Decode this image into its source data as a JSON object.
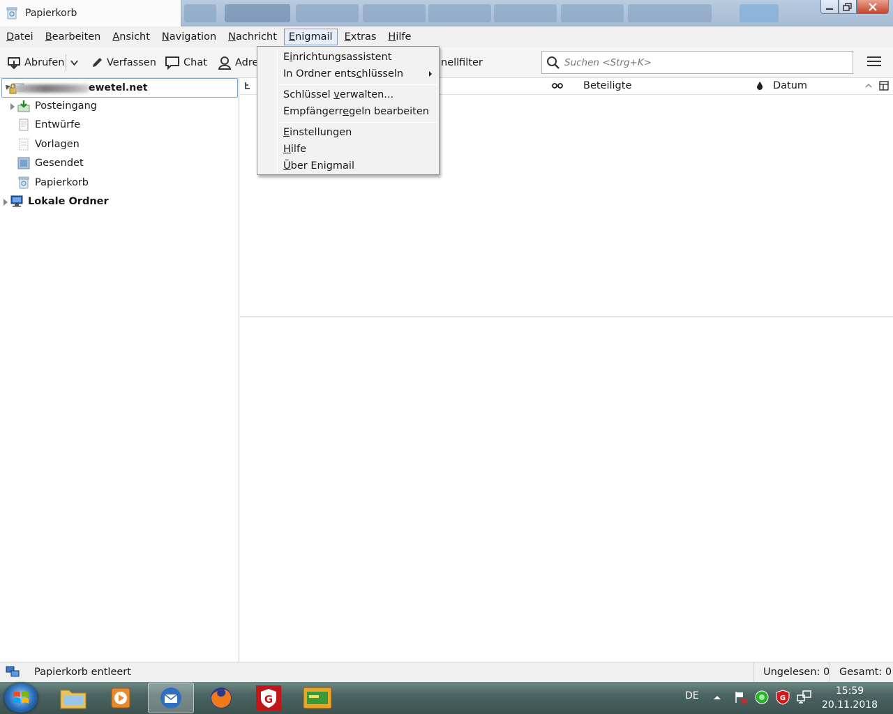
{
  "window": {
    "tab_title": "Papierkorb",
    "tab_icon": "trash-icon"
  },
  "menubar": {
    "items": [
      "Datei",
      "Bearbeiten",
      "Ansicht",
      "Navigation",
      "Nachricht",
      "Enigmail",
      "Extras",
      "Hilfe"
    ],
    "active": "Enigmail"
  },
  "toolbar": {
    "abrufen": "Abrufen",
    "verfassen": "Verfassen",
    "chat": "Chat",
    "adressbuch": "Adre",
    "schnellfilter": "nellfilter",
    "search_placeholder": "Suchen <Strg+K>"
  },
  "enigmail_menu": {
    "items": [
      {
        "label": "Einrichtungsassistent",
        "has_submenu": false
      },
      {
        "label": "In Ordner entschlüsseln",
        "has_submenu": true
      },
      {
        "label": "Schlüssel verwalten...",
        "has_submenu": false
      },
      {
        "label": "Empfängerregeln bearbeiten",
        "has_submenu": false
      },
      {
        "label": "Einstellungen",
        "has_submenu": false
      },
      {
        "label": "Hilfe",
        "has_submenu": false
      },
      {
        "label": "Über Enigmail",
        "has_submenu": false
      }
    ]
  },
  "folders": {
    "account_suffix": "ewetel.net",
    "items": [
      {
        "label": "Posteingang",
        "icon": "inbox-icon"
      },
      {
        "label": "Entwürfe",
        "icon": "drafts-icon"
      },
      {
        "label": "Vorlagen",
        "icon": "templates-icon"
      },
      {
        "label": "Gesendet",
        "icon": "sent-icon"
      },
      {
        "label": "Papierkorb",
        "icon": "trash-icon"
      }
    ],
    "local": "Lokale Ordner"
  },
  "thread_columns": {
    "participants": "Beteiligte",
    "date": "Datum"
  },
  "status": {
    "message": "Papierkorb entleert",
    "unread": "Ungelesen: 0",
    "total": "Gesamt: 0"
  },
  "taskbar": {
    "language": "DE",
    "time": "15:59",
    "date": "20.11.2018"
  }
}
